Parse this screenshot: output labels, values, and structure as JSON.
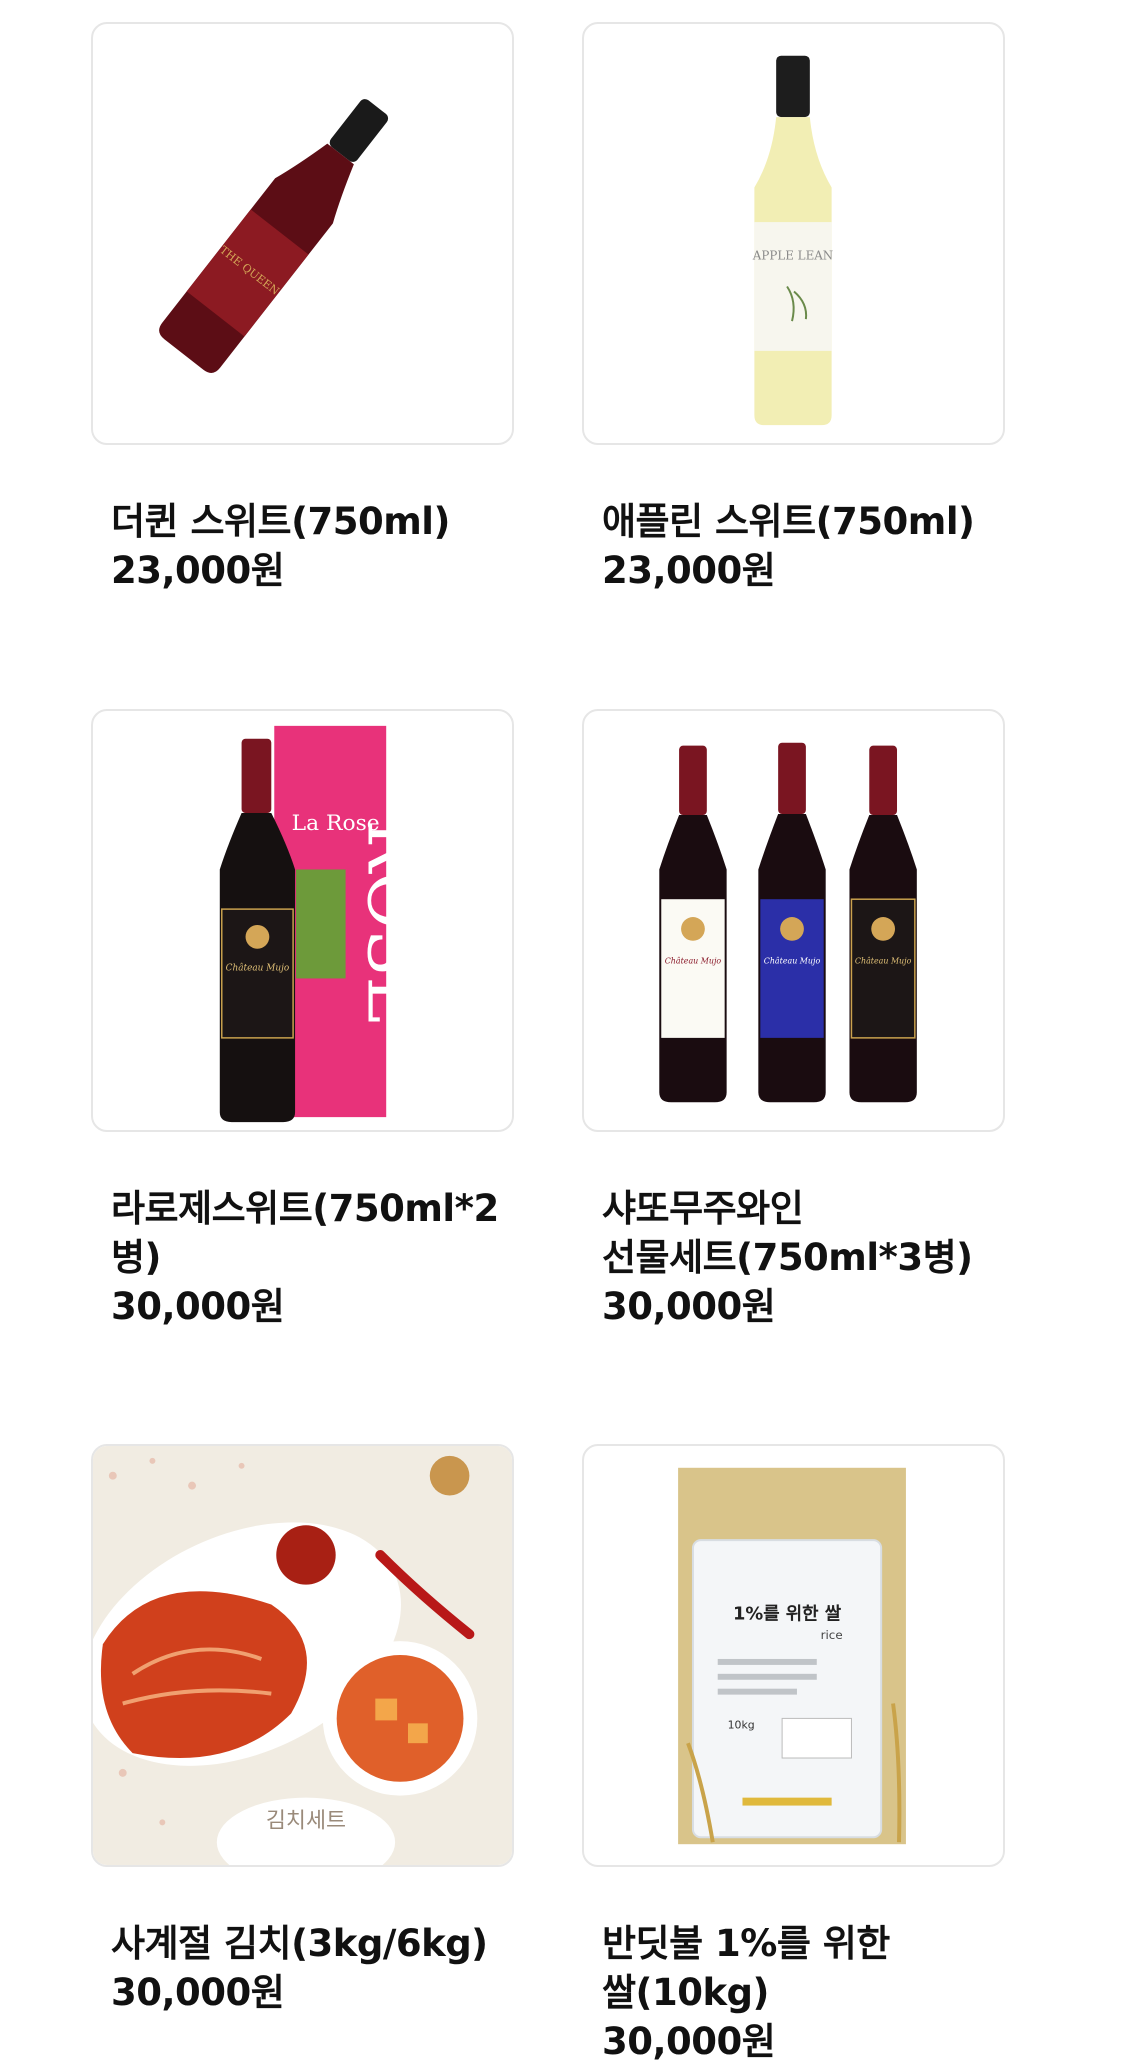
{
  "products": [
    {
      "name": "더퀸 스위트(750ml)",
      "price": "23,000원",
      "image": "red-wine-bottle-image",
      "label_text": "THE QUEEN"
    },
    {
      "name": "애플린 스위트(750ml)",
      "price": "23,000원",
      "image": "white-wine-bottle-image",
      "label_text": "APPLE LEAN"
    },
    {
      "name": "라로제스위트(750ml*2병)",
      "price": "30,000원",
      "image": "rose-wine-gift-box-image",
      "label_text": "La Rose",
      "box_text": "ROSE",
      "bottle_label": "Château Mujo"
    },
    {
      "name": "샤또무주와인\n선물세트(750ml*3병)",
      "price": "30,000원",
      "image": "three-wine-bottles-image",
      "bottle_label": "Château Mujo"
    },
    {
      "name": "사계절 김치(3kg/6kg)",
      "price": "30,000원",
      "image": "kimchi-image",
      "badge_text": "김치세트"
    },
    {
      "name": "반딧불 1%를 위한\n쌀(10kg)",
      "price": "30,000원",
      "image": "rice-bag-image",
      "label_text": "1%를 위한 쌀",
      "label_sub": "rice",
      "weight_text": "10kg"
    }
  ],
  "colors": {
    "card_border": "#e6e6e6",
    "text": "#111111",
    "red_wine": "#6b0f18",
    "white_wine": "#f0ecb0",
    "rose_box": "#e8327a",
    "kimchi": "#d0401c"
  }
}
